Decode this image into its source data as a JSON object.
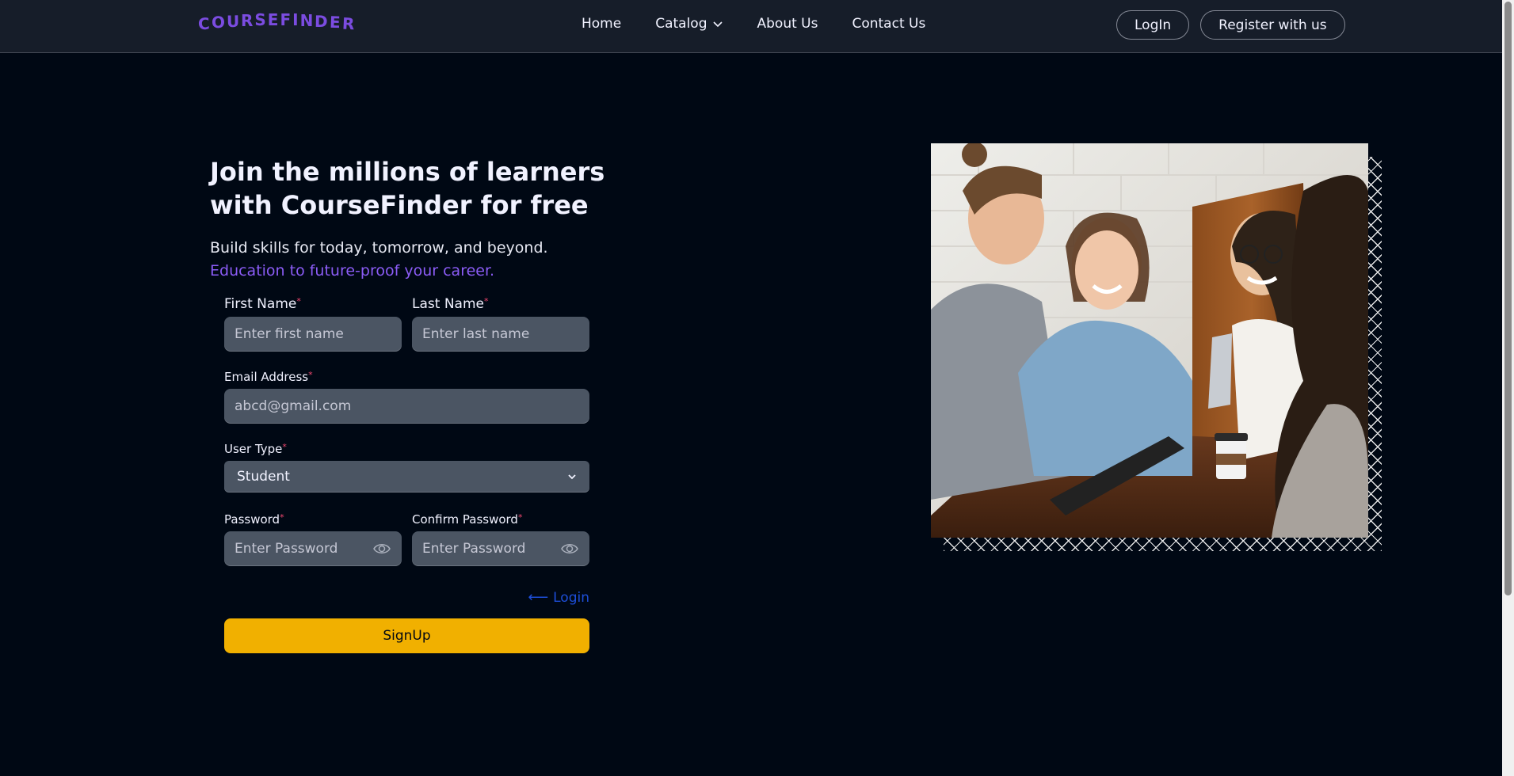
{
  "brand": {
    "logo_text": "COURSEFINDER"
  },
  "nav": {
    "links": [
      "Home",
      "Catalog",
      "About Us",
      "Contact Us"
    ],
    "login_label": "LogIn",
    "register_label": "Register with us"
  },
  "hero": {
    "headline": "Join the millions of learners with CourseFinder for free",
    "subtitle": "Build skills for today, tomorrow, and beyond.",
    "highlight": "Education to future-proof your career."
  },
  "form": {
    "first_name": {
      "label": "First Name",
      "placeholder": "Enter first name"
    },
    "last_name": {
      "label": "Last Name",
      "placeholder": "Enter last name"
    },
    "email": {
      "label": "Email Address",
      "placeholder": "abcd@gmail.com"
    },
    "user_type": {
      "label": "User Type",
      "value": "Student"
    },
    "password": {
      "label": "Password",
      "placeholder": "Enter Password"
    },
    "confirm_password": {
      "label": "Confirm Password",
      "placeholder": "Enter Password"
    },
    "required_mark": "*",
    "login_link": "Login",
    "login_arrow": "⟵",
    "submit_label": "SignUp"
  },
  "colors": {
    "background": "#000814",
    "navbar": "#161d29",
    "accent_purple": "#8b5cf6",
    "button_yellow": "#f1b000",
    "link_blue": "#1d4ed8",
    "required_red": "#ef476f",
    "input_bg": "#4b5563"
  },
  "icons": {
    "catalog_chevron": "chevron-down-icon",
    "password_toggle": "eye-icon",
    "login_arrow": "arrow-left-icon"
  }
}
